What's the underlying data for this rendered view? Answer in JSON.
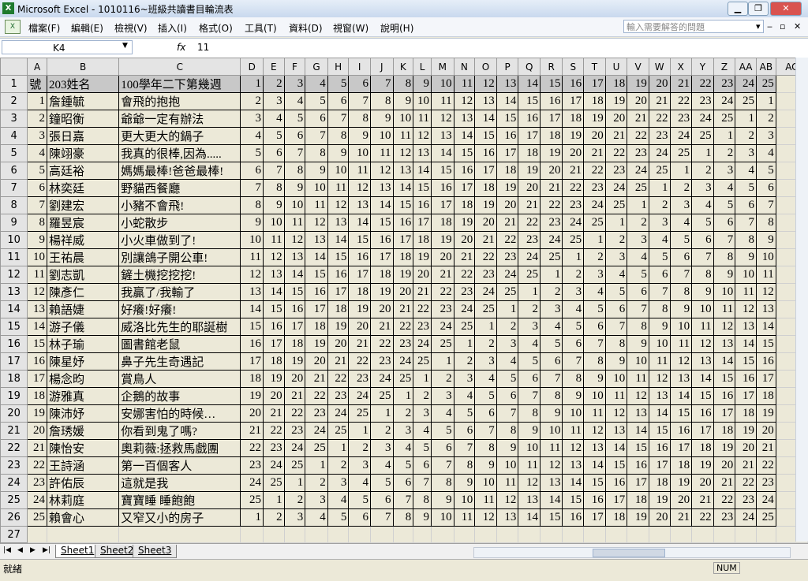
{
  "window": {
    "title": "Microsoft Excel - 1010116~班級共讀書目輪流表",
    "app_icon": "X"
  },
  "menu": {
    "items": [
      "檔案(F)",
      "編輯(E)",
      "檢視(V)",
      "插入(I)",
      "格式(O)",
      "工具(T)",
      "資料(D)",
      "視窗(W)",
      "說明(H)"
    ],
    "help_placeholder": "輸入需要解答的問題"
  },
  "formula_bar": {
    "name_box": "K4",
    "fx": "fx",
    "value": "11"
  },
  "columns": [
    "",
    "A",
    "B",
    "C",
    "D",
    "E",
    "F",
    "G",
    "H",
    "I",
    "J",
    "K",
    "L",
    "M",
    "N",
    "O",
    "P",
    "Q",
    "R",
    "S",
    "T",
    "U",
    "V",
    "W",
    "X",
    "Y",
    "Z",
    "AA",
    "AB",
    "AC"
  ],
  "rows": [
    [
      "號",
      "203姓名",
      "100學年二下第幾週",
      1,
      2,
      3,
      4,
      5,
      6,
      7,
      8,
      9,
      10,
      11,
      12,
      13,
      14,
      15,
      16,
      17,
      18,
      19,
      20,
      21,
      22,
      23,
      24,
      25
    ],
    [
      1,
      "詹鍾毓",
      "會飛的抱抱",
      2,
      3,
      4,
      5,
      6,
      7,
      8,
      9,
      10,
      11,
      12,
      13,
      14,
      15,
      16,
      17,
      18,
      19,
      20,
      21,
      22,
      23,
      24,
      25,
      1
    ],
    [
      2,
      "鐘昭衡",
      "爺爺一定有辦法",
      3,
      4,
      5,
      6,
      7,
      8,
      9,
      10,
      11,
      12,
      13,
      14,
      15,
      16,
      17,
      18,
      19,
      20,
      21,
      22,
      23,
      24,
      25,
      1,
      2
    ],
    [
      3,
      "張日嘉",
      "更大更大的鍋子",
      4,
      5,
      6,
      7,
      8,
      9,
      10,
      11,
      12,
      13,
      14,
      15,
      16,
      17,
      18,
      19,
      20,
      21,
      22,
      23,
      24,
      25,
      1,
      2,
      3
    ],
    [
      4,
      "陳翊豪",
      "我真的很棒,因為.....",
      5,
      6,
      7,
      8,
      9,
      10,
      11,
      12,
      13,
      14,
      15,
      16,
      17,
      18,
      19,
      20,
      21,
      22,
      23,
      24,
      25,
      1,
      2,
      3,
      4
    ],
    [
      5,
      "高廷裕",
      "媽媽最棒!爸爸最棒!",
      6,
      7,
      8,
      9,
      10,
      11,
      12,
      13,
      14,
      15,
      16,
      17,
      18,
      19,
      20,
      21,
      22,
      23,
      24,
      25,
      1,
      2,
      3,
      4,
      5
    ],
    [
      6,
      "林奕廷",
      "野貓西餐廳",
      7,
      8,
      9,
      10,
      11,
      12,
      13,
      14,
      15,
      16,
      17,
      18,
      19,
      20,
      21,
      22,
      23,
      24,
      25,
      1,
      2,
      3,
      4,
      5,
      6
    ],
    [
      7,
      "劉建宏",
      "小豬不會飛!",
      8,
      9,
      10,
      11,
      12,
      13,
      14,
      15,
      16,
      17,
      18,
      19,
      20,
      21,
      22,
      23,
      24,
      25,
      1,
      2,
      3,
      4,
      5,
      6,
      7
    ],
    [
      8,
      "羅昱宸",
      "小蛇散步",
      9,
      10,
      11,
      12,
      13,
      14,
      15,
      16,
      17,
      18,
      19,
      20,
      21,
      22,
      23,
      24,
      25,
      1,
      2,
      3,
      4,
      5,
      6,
      7,
      8
    ],
    [
      9,
      "楊祥威",
      "小火車做到了!",
      10,
      11,
      12,
      13,
      14,
      15,
      16,
      17,
      18,
      19,
      20,
      21,
      22,
      23,
      24,
      25,
      1,
      2,
      3,
      4,
      5,
      6,
      7,
      8,
      9
    ],
    [
      10,
      "王祐晨",
      "別讓鴿子開公車!",
      11,
      12,
      13,
      14,
      15,
      16,
      17,
      18,
      19,
      20,
      21,
      22,
      23,
      24,
      25,
      1,
      2,
      3,
      4,
      5,
      6,
      7,
      8,
      9,
      10
    ],
    [
      11,
      "劉志凱",
      "鏟土機挖挖挖!",
      12,
      13,
      14,
      15,
      16,
      17,
      18,
      19,
      20,
      21,
      22,
      23,
      24,
      25,
      1,
      2,
      3,
      4,
      5,
      6,
      7,
      8,
      9,
      10,
      11
    ],
    [
      12,
      "陳彥仁",
      "我贏了/我輸了",
      13,
      14,
      15,
      16,
      17,
      18,
      19,
      20,
      21,
      22,
      23,
      24,
      25,
      1,
      2,
      3,
      4,
      5,
      6,
      7,
      8,
      9,
      10,
      11,
      12
    ],
    [
      13,
      "賴語婕",
      "好癢!好癢!",
      14,
      15,
      16,
      17,
      18,
      19,
      20,
      21,
      22,
      23,
      24,
      25,
      1,
      2,
      3,
      4,
      5,
      6,
      7,
      8,
      9,
      10,
      11,
      12,
      13
    ],
    [
      14,
      "游子儀",
      "威洛比先生的耶誕樹",
      15,
      16,
      17,
      18,
      19,
      20,
      21,
      22,
      23,
      24,
      25,
      1,
      2,
      3,
      4,
      5,
      6,
      7,
      8,
      9,
      10,
      11,
      12,
      13,
      14
    ],
    [
      15,
      "林子瑜",
      "圖書館老鼠",
      16,
      17,
      18,
      19,
      20,
      21,
      22,
      23,
      24,
      25,
      1,
      2,
      3,
      4,
      5,
      6,
      7,
      8,
      9,
      10,
      11,
      12,
      13,
      14,
      15
    ],
    [
      16,
      "陳星妤",
      "鼻子先生奇遇記",
      17,
      18,
      19,
      20,
      21,
      22,
      23,
      24,
      25,
      1,
      2,
      3,
      4,
      5,
      6,
      7,
      8,
      9,
      10,
      11,
      12,
      13,
      14,
      15,
      16
    ],
    [
      17,
      "楊念昀",
      "賞鳥人",
      18,
      19,
      20,
      21,
      22,
      23,
      24,
      25,
      1,
      2,
      3,
      4,
      5,
      6,
      7,
      8,
      9,
      10,
      11,
      12,
      13,
      14,
      15,
      16,
      17
    ],
    [
      18,
      "游雅真",
      "企鵝的故事",
      19,
      20,
      21,
      22,
      23,
      24,
      25,
      1,
      2,
      3,
      4,
      5,
      6,
      7,
      8,
      9,
      10,
      11,
      12,
      13,
      14,
      15,
      16,
      17,
      18
    ],
    [
      19,
      "陳沛妤",
      "安娜害怕的時候…",
      20,
      21,
      22,
      23,
      24,
      25,
      1,
      2,
      3,
      4,
      5,
      6,
      7,
      8,
      9,
      10,
      11,
      12,
      13,
      14,
      15,
      16,
      17,
      18,
      19
    ],
    [
      20,
      "詹琇媛",
      "你看到鬼了嗎?",
      21,
      22,
      23,
      24,
      25,
      1,
      2,
      3,
      4,
      5,
      6,
      7,
      8,
      9,
      10,
      11,
      12,
      13,
      14,
      15,
      16,
      17,
      18,
      19,
      20
    ],
    [
      21,
      "陳怡安",
      "奧莉薇:拯救馬戲團",
      22,
      23,
      24,
      25,
      1,
      2,
      3,
      4,
      5,
      6,
      7,
      8,
      9,
      10,
      11,
      12,
      13,
      14,
      15,
      16,
      17,
      18,
      19,
      20,
      21
    ],
    [
      22,
      "王詩涵",
      "第一百個客人",
      23,
      24,
      25,
      1,
      2,
      3,
      4,
      5,
      6,
      7,
      8,
      9,
      10,
      11,
      12,
      13,
      14,
      15,
      16,
      17,
      18,
      19,
      20,
      21,
      22
    ],
    [
      23,
      "許佑辰",
      "這就是我",
      24,
      25,
      1,
      2,
      3,
      4,
      5,
      6,
      7,
      8,
      9,
      10,
      11,
      12,
      13,
      14,
      15,
      16,
      17,
      18,
      19,
      20,
      21,
      22,
      23
    ],
    [
      24,
      "林莉庭",
      "寶寶睡 睡飽飽",
      25,
      1,
      2,
      3,
      4,
      5,
      6,
      7,
      8,
      9,
      10,
      11,
      12,
      13,
      14,
      15,
      16,
      17,
      18,
      19,
      20,
      21,
      22,
      23,
      24
    ],
    [
      25,
      "賴會心",
      "又窄又小的房子",
      1,
      2,
      3,
      4,
      5,
      6,
      7,
      8,
      9,
      10,
      11,
      12,
      13,
      14,
      15,
      16,
      17,
      18,
      19,
      20,
      21,
      22,
      23,
      24,
      25
    ]
  ],
  "sheet_tabs": [
    "Sheet1",
    "Sheet2",
    "Sheet3"
  ],
  "active_sheet": "Sheet1",
  "status": {
    "ready": "就緒",
    "num": "NUM"
  }
}
